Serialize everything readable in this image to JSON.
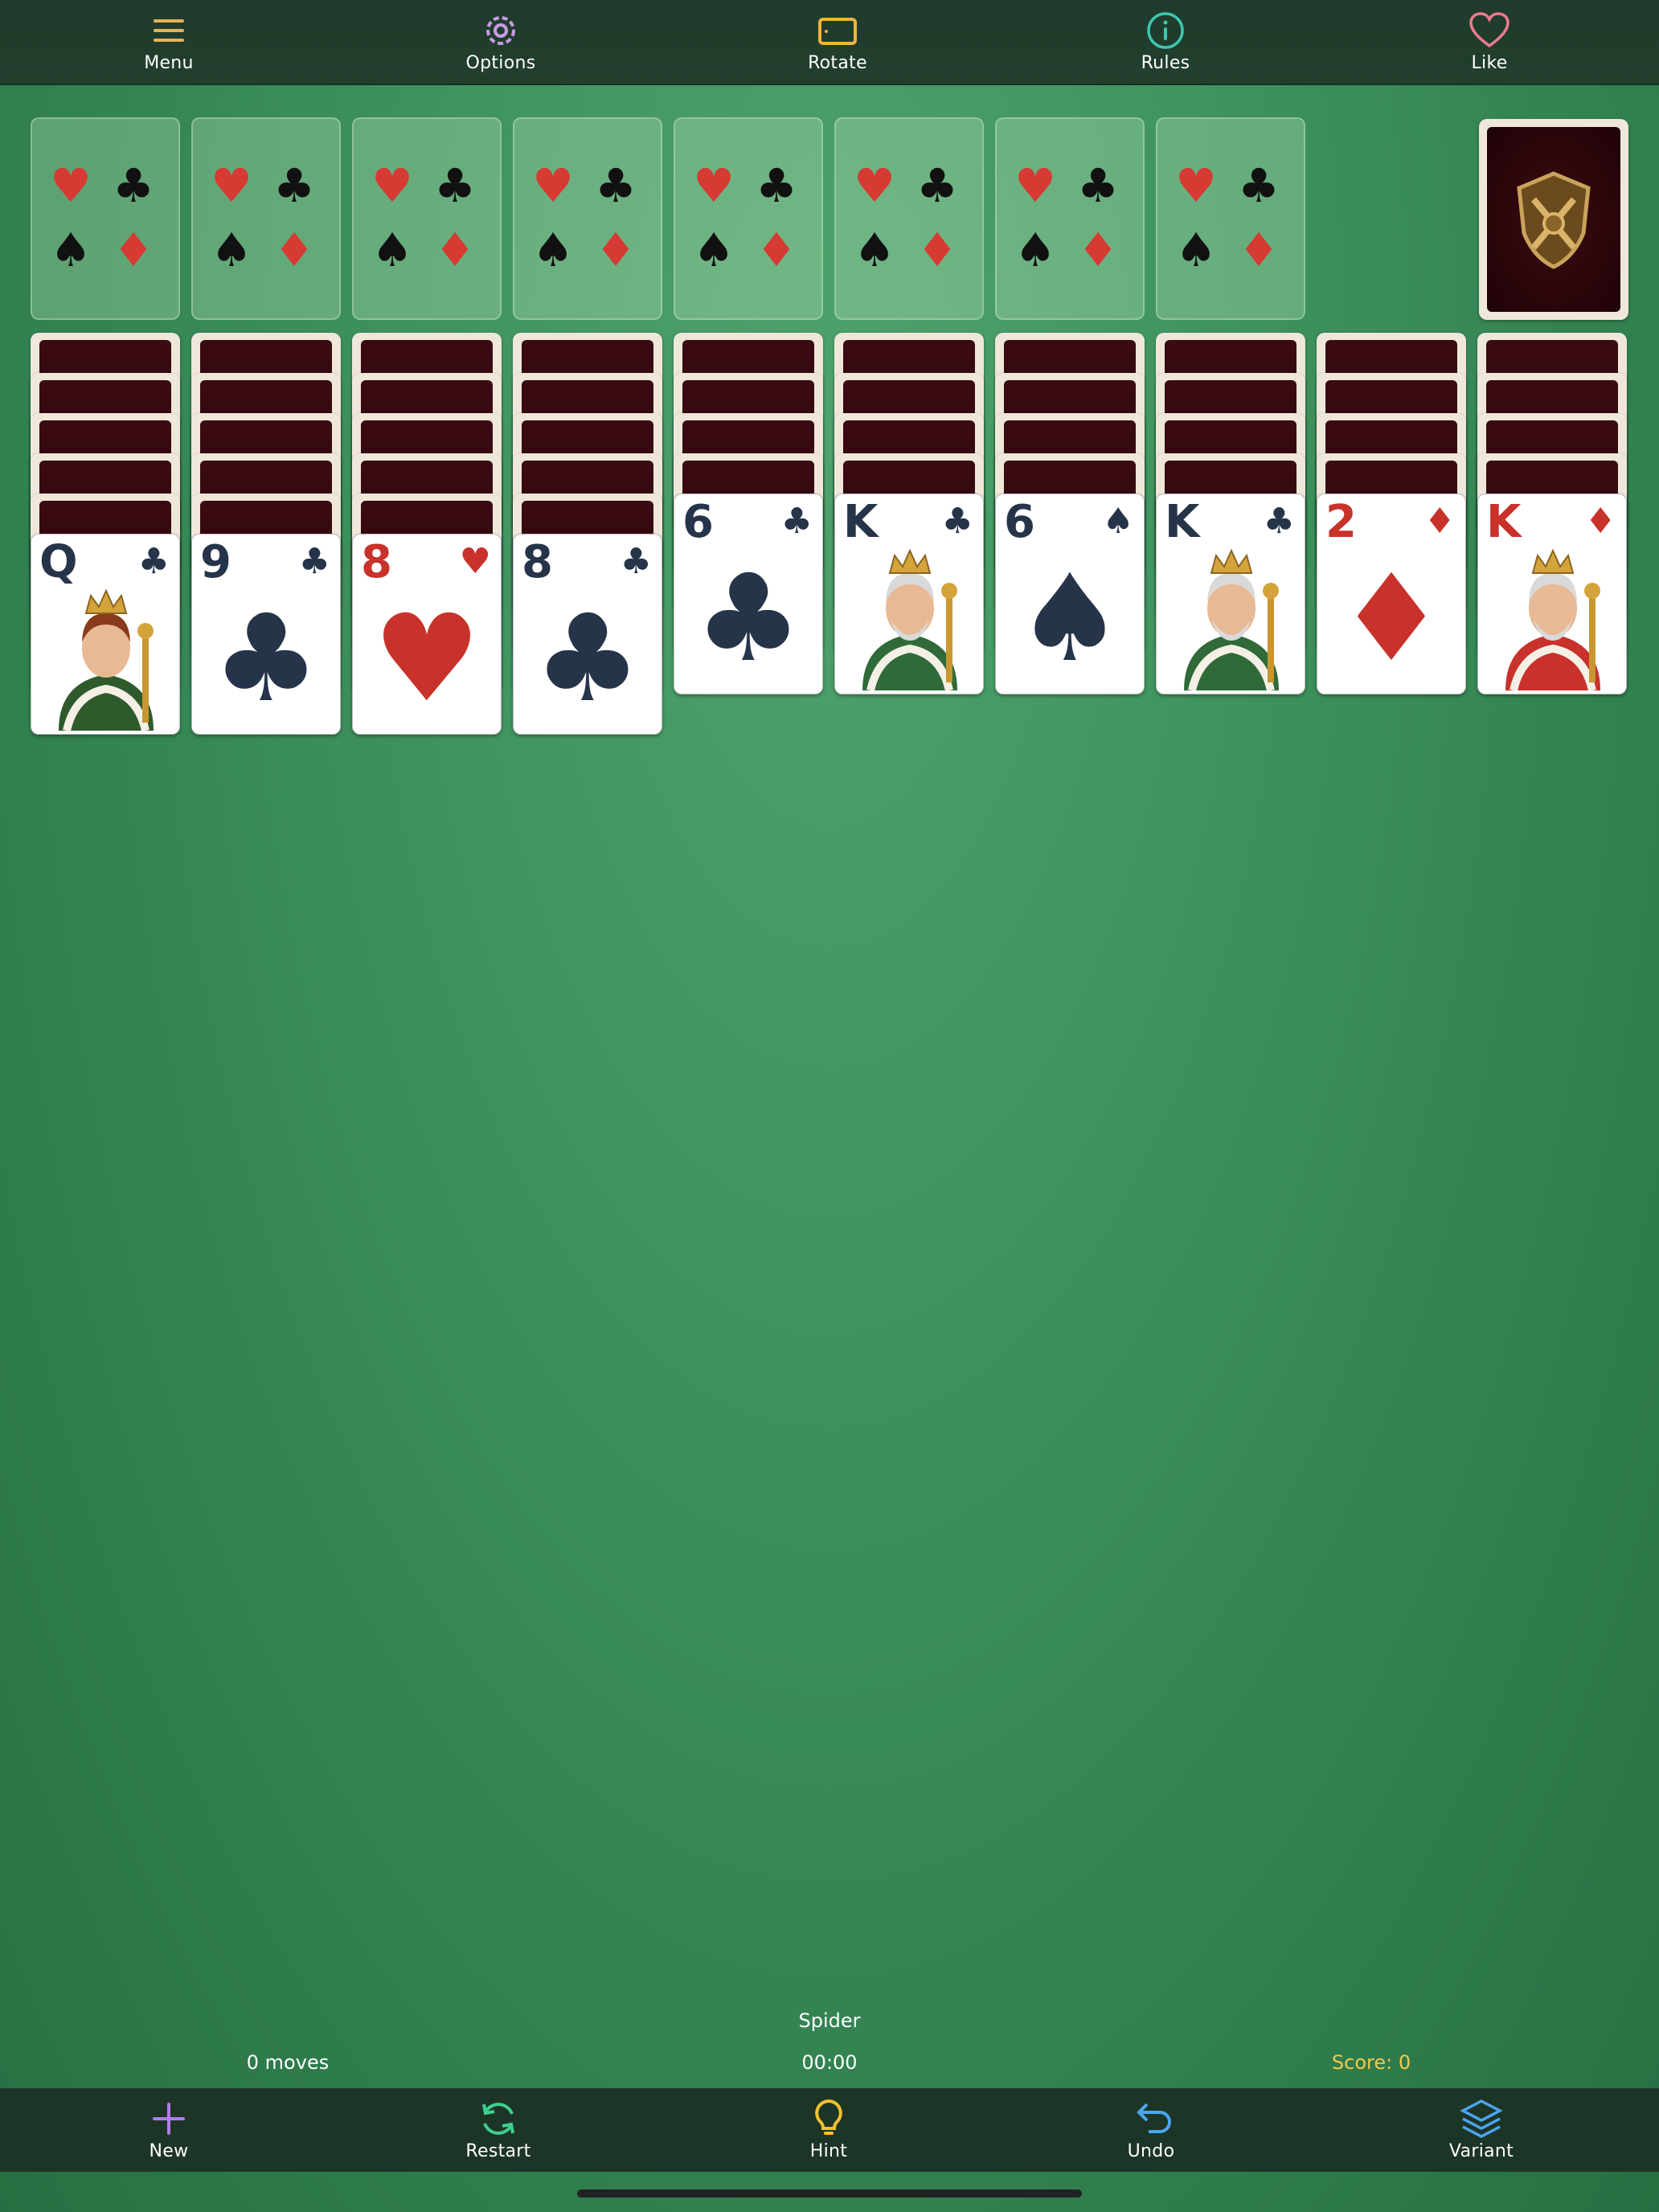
{
  "top_bar": {
    "menu": "Menu",
    "options": "Options",
    "rotate": "Rotate",
    "rules": "Rules",
    "like": "Like"
  },
  "foundation_slots": 8,
  "tableau": [
    {
      "rank": "Q",
      "suit": "♣",
      "color": "black",
      "face": true
    },
    {
      "rank": "9",
      "suit": "♣",
      "color": "black",
      "face": false
    },
    {
      "rank": "8",
      "suit": "♥",
      "color": "red",
      "face": false
    },
    {
      "rank": "8",
      "suit": "♣",
      "color": "black",
      "face": false
    },
    {
      "rank": "6",
      "suit": "♣",
      "color": "black",
      "face": false
    },
    {
      "rank": "K",
      "suit": "♣",
      "color": "black",
      "face": true
    },
    {
      "rank": "6",
      "suit": "♠",
      "color": "black",
      "face": false
    },
    {
      "rank": "K",
      "suit": "♣",
      "color": "black",
      "face": true
    },
    {
      "rank": "2",
      "suit": "♦",
      "color": "red",
      "face": false
    },
    {
      "rank": "K",
      "suit": "♦",
      "color": "red",
      "face": true
    }
  ],
  "facedown_counts": [
    5,
    5,
    5,
    5,
    4,
    4,
    4,
    4,
    4,
    4
  ],
  "status": {
    "game_name": "Spider",
    "moves": "0 moves",
    "timer": "00:00",
    "score": "Score: 0"
  },
  "bottom_bar": {
    "new": "New",
    "restart": "Restart",
    "hint": "Hint",
    "undo": "Undo",
    "variant": "Variant"
  },
  "colors": {
    "felt": "#3f935f",
    "menu_icon": "#e3b35a",
    "options_icon": "#c99be6",
    "rotate_icon": "#f2b33d",
    "rules_icon": "#3fc6b0",
    "like_icon": "#f07a93",
    "new_icon": "#b27cf0",
    "restart_icon": "#3ecf8e",
    "hint_icon": "#f2c12e",
    "undo_icon": "#4aa6f0",
    "variant_icon": "#4aa6f0"
  }
}
